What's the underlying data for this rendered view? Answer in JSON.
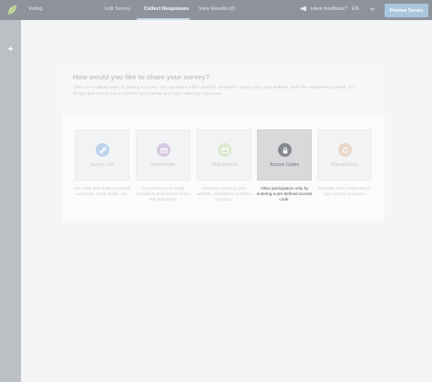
{
  "header": {
    "survey_title": "Voting",
    "nav": [
      "Edit Survey",
      "Collect Responses",
      "View Results (0)"
    ],
    "active_nav_index": 1,
    "feedback_label": "Have feedback?",
    "language": "EN",
    "preview_label": "Preview Survey"
  },
  "sidebar": {
    "add_label": "+"
  },
  "collect": {
    "title": "How would you like to share your survey?",
    "description": "There are multiple ways of sharing a survey. You can share a link yourself, embed the survey onto your website, invite the responses yourself, etc. Simply pick one or many collector types below and start collecting responses.",
    "options": [
      {
        "label": "Survey Link",
        "icon": "link-icon",
        "color": "#bcd3ea",
        "description": "Get a link and share it yourself via email, social media, etc.",
        "selected": false
      },
      {
        "label": "Email Invite",
        "icon": "mail-icon",
        "color": "#d8c9e2",
        "description": "Let us send your email invitations and connect them with responses.",
        "selected": false
      },
      {
        "label": "Web Embed",
        "icon": "code-icon",
        "color": "#dce7cd",
        "description": "Add your survey to your website, embedded as iframe or popup.",
        "selected": false
      },
      {
        "label": "Access Codes",
        "icon": "lock-icon",
        "color": "#85888d",
        "description": "Allow participation only by entering a pre-defined access code.",
        "selected": true
      },
      {
        "label": "Manual Entry",
        "icon": "refresh-icon",
        "color": "#e8d6c9",
        "description": "Manually enter responses to your survey, reviewed.",
        "selected": false
      }
    ]
  }
}
